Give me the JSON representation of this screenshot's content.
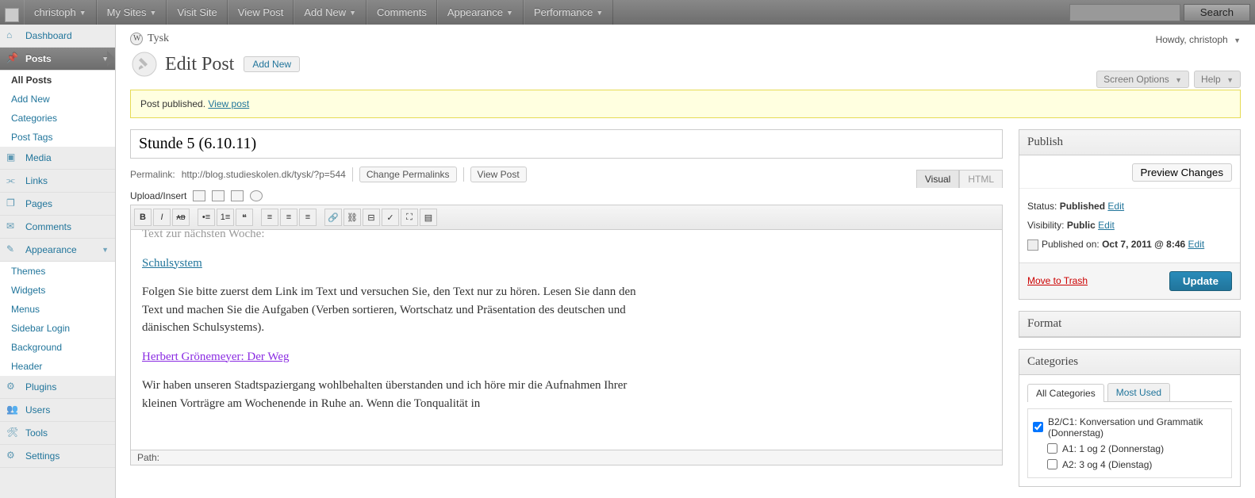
{
  "adminbar": {
    "user": "christoph",
    "items": [
      "My Sites",
      "Visit Site",
      "View Post",
      "Add New",
      "Comments",
      "Appearance",
      "Performance"
    ],
    "dropdown_idx": [
      0,
      3,
      5,
      6
    ],
    "search_btn": "Search"
  },
  "breadcrumb": {
    "site_name": "Tysk"
  },
  "howdy": "Howdy, christoph",
  "screen_tabs": [
    "Screen Options",
    "Help"
  ],
  "page_title": "Edit Post",
  "add_new_label": "Add New",
  "notice": {
    "text": "Post published. ",
    "link": "View post"
  },
  "title_input": "Stunde 5 (6.10.11)",
  "permalink": {
    "label": "Permalink:",
    "url": "http://blog.studieskolen.dk/tysk/?p=544",
    "change": "Change Permalinks",
    "view": "View Post"
  },
  "upload_label": "Upload/Insert",
  "editor_tabs": {
    "visual": "Visual",
    "html": "HTML"
  },
  "editor": {
    "line0": "Text zur nächsten Woche:",
    "link1": "Schulsystem",
    "para1": "Folgen Sie bitte zuerst dem Link im Text und versuchen Sie, den Text nur zu hören. Lesen Sie dann den Text und machen Sie die Aufgaben (Verben sortieren, Wortschatz und Präsentation des deutschen und dänischen Schulsystems).",
    "link2": "Herbert Grönemeyer: Der Weg",
    "para2": "Wir haben unseren Stadtspaziergang wohlbehalten überstanden und ich höre mir die Aufnahmen Ihrer kleinen Vorträgre am Wochenende in Ruhe an. Wenn die Tonqualität in"
  },
  "path_label": "Path:",
  "sidebar": {
    "dashboard": "Dashboard",
    "posts": "Posts",
    "posts_sub": [
      "All Posts",
      "Add New",
      "Categories",
      "Post Tags"
    ],
    "media": "Media",
    "links": "Links",
    "pages": "Pages",
    "comments": "Comments",
    "appearance": "Appearance",
    "appearance_sub": [
      "Themes",
      "Widgets",
      "Menus",
      "Sidebar Login",
      "Background",
      "Header"
    ],
    "plugins": "Plugins",
    "users": "Users",
    "tools": "Tools",
    "settings": "Settings"
  },
  "publish": {
    "title": "Publish",
    "preview": "Preview Changes",
    "status_label": "Status:",
    "status_val": "Published",
    "visibility_label": "Visibility:",
    "visibility_val": "Public",
    "published_on_label": "Published on:",
    "published_on_val": "Oct 7, 2011 @ 8:46",
    "edit": "Edit",
    "trash": "Move to Trash",
    "update": "Update"
  },
  "format": {
    "title": "Format"
  },
  "categories": {
    "title": "Categories",
    "tab_all": "All Categories",
    "tab_most": "Most Used",
    "items": [
      {
        "label": "B2/C1: Konversation und Grammatik (Donnerstag)",
        "checked": true
      },
      {
        "label": "A1: 1 og 2 (Donnerstag)",
        "checked": false
      },
      {
        "label": "A2: 3 og 4 (Dienstag)",
        "checked": false
      }
    ]
  }
}
